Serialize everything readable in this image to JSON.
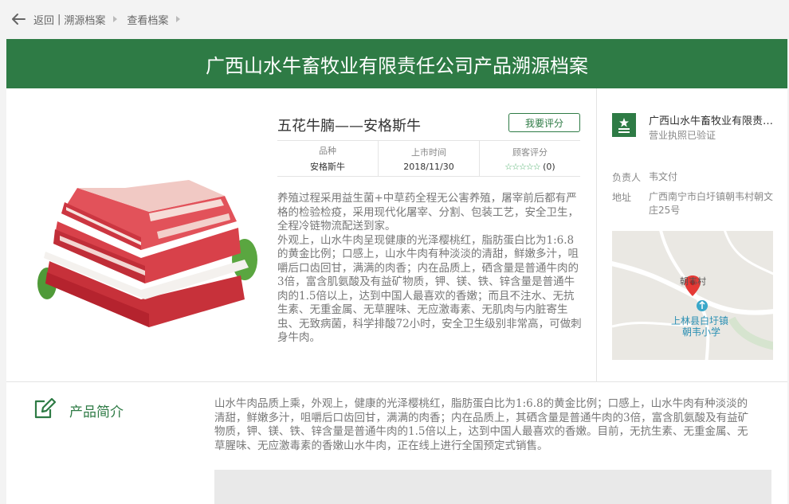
{
  "nav": {
    "back_label": "返回",
    "crumb_1": "溯源档案",
    "crumb_2": "查看档案",
    "separator": "|"
  },
  "banner_title": "广西山水牛畜牧业有限责任公司产品溯源档案",
  "product": {
    "name": "五花牛腩——安格斯牛",
    "rate_button": "我要评分",
    "meta": [
      {
        "label": "品种",
        "value": "安格斯牛"
      },
      {
        "label": "上市时间",
        "value": "2018/11/30"
      },
      {
        "label": "顾客评分",
        "value": "(0)"
      }
    ],
    "stars": "☆☆☆☆☆",
    "description_1": "养殖过程采用益生菌+中草药全程无公害养殖，屠宰前后都有严格的检验检疫，采用现代化屠宰、分割、包装工艺，安全卫生，全程冷链物流配送到家。",
    "description_2": "外观上，山水牛肉呈现健康的光泽樱桃红，脂肪蛋白比为1:6.8的黄金比例；口感上，山水牛肉有种淡淡的清甜，鲜嫩多汁，咀嚼后口齿回甘，满满的肉香；内在品质上，硒含量是普通牛肉的3倍，富含肌氨酸及有益矿物质，钾、镁、铁、锌含量是普通牛肉的1.5倍以上，达到中国人最喜欢的香嫩；而且不注水、无抗生素、无重金属、无草腥味、无应激毒素、无肌肉与内脏寄生虫、无致病菌，科学排酸72小时，安全卫生级别非常高，可做刺身牛肉。"
  },
  "company": {
    "name": "广西山水牛畜牧业有限责任公司",
    "verified": "营业执照已验证",
    "owner_label": "负责人",
    "owner_value": "韦文付",
    "address_label": "地址",
    "address_value": "广西南宁市白圩镇朝韦村朝文庄25号",
    "map": {
      "village_label": "朝韦村",
      "school_line_1": "上林县白圩镇",
      "school_line_2": "朝韦小学"
    }
  },
  "intro": {
    "title": "产品简介",
    "text": "山水牛肉品质上乘，外观上，健康的光泽樱桃红，脂肪蛋白比为1:6.8的黄金比例；口感上，山水牛肉有种淡淡的清甜，鲜嫩多汁，咀嚼后口齿回甘，满满的肉香；内在品质上，其硒含量是普通牛肉的3倍，富含肌氨酸及有益矿物质，钾、镁、铁、锌含量是普通牛肉的1.5倍以上，达到中国人最喜欢的香嫩。目前，无抗生素、无重金属、无草腥味、无应激毒素的香嫩山水牛肉，正在线上进行全国预定式销售。"
  },
  "colors": {
    "brand_green": "#2e7b45",
    "star_green": "#4caf6a",
    "map_pin": "#e53935"
  },
  "icons": {
    "back": "arrow-left-icon",
    "breadcrumb_separator": "triangle-right-icon",
    "company_logo": "star-flag-icon",
    "map_pin": "location-pin-icon",
    "map_poi": "school-poi-icon",
    "section": "edit-note-icon"
  }
}
